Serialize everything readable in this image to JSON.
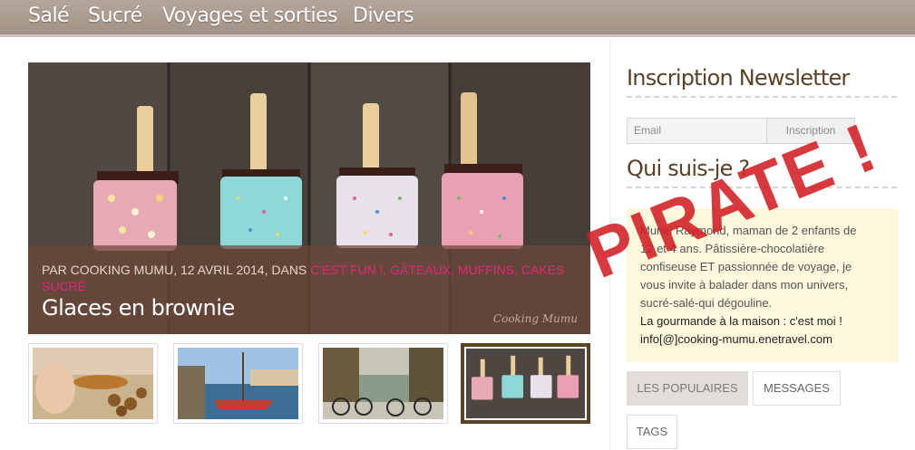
{
  "nav": {
    "items": [
      "Salé",
      "Sucré",
      "Voyages et sorties",
      "Divers"
    ]
  },
  "slider": {
    "meta_prefix": "Par Cooking Mumu, 12 avril 2014, dans ",
    "categories_line1": "C'est fun !, Gâteaux, muffins, cakes",
    "categories_line2": "Sucré",
    "title": "Glaces en brownie",
    "watermark": "Cooking Mumu"
  },
  "thumbnails": [
    {
      "label": "cookies"
    },
    {
      "label": "harbor boats"
    },
    {
      "label": "canal bikes"
    },
    {
      "label": "brownie ice creams"
    }
  ],
  "newsletter": {
    "heading": "Inscription Newsletter",
    "email_placeholder": "Email",
    "button_label": "Inscription"
  },
  "about": {
    "heading": "Qui suis-je ?",
    "lines": [
      "Muriel Raymond, maman de 2 enfants de",
      "12 et 4 ans. Pâtissière-chocolatière",
      "confiseuse ET passionnée de voyage, je",
      "vous invite à balader dans mon univers,",
      "sucré-salé-qui dégouline.",
      "La gourmande à la maison : c'est moi !",
      "info[@]cooking-mumu.enetravel.com"
    ]
  },
  "tabs": {
    "popular": "LES POPULAIRES",
    "messages": "MESSAGES",
    "tags": "TAGS"
  },
  "overlay_stamp": "PIRATE !",
  "colors": {
    "nav_bg": "#a89a8f",
    "heading": "#5b4126",
    "category_link": "#e0287a",
    "stamp": "#d21e23",
    "about_bg": "#fcf7dd"
  }
}
